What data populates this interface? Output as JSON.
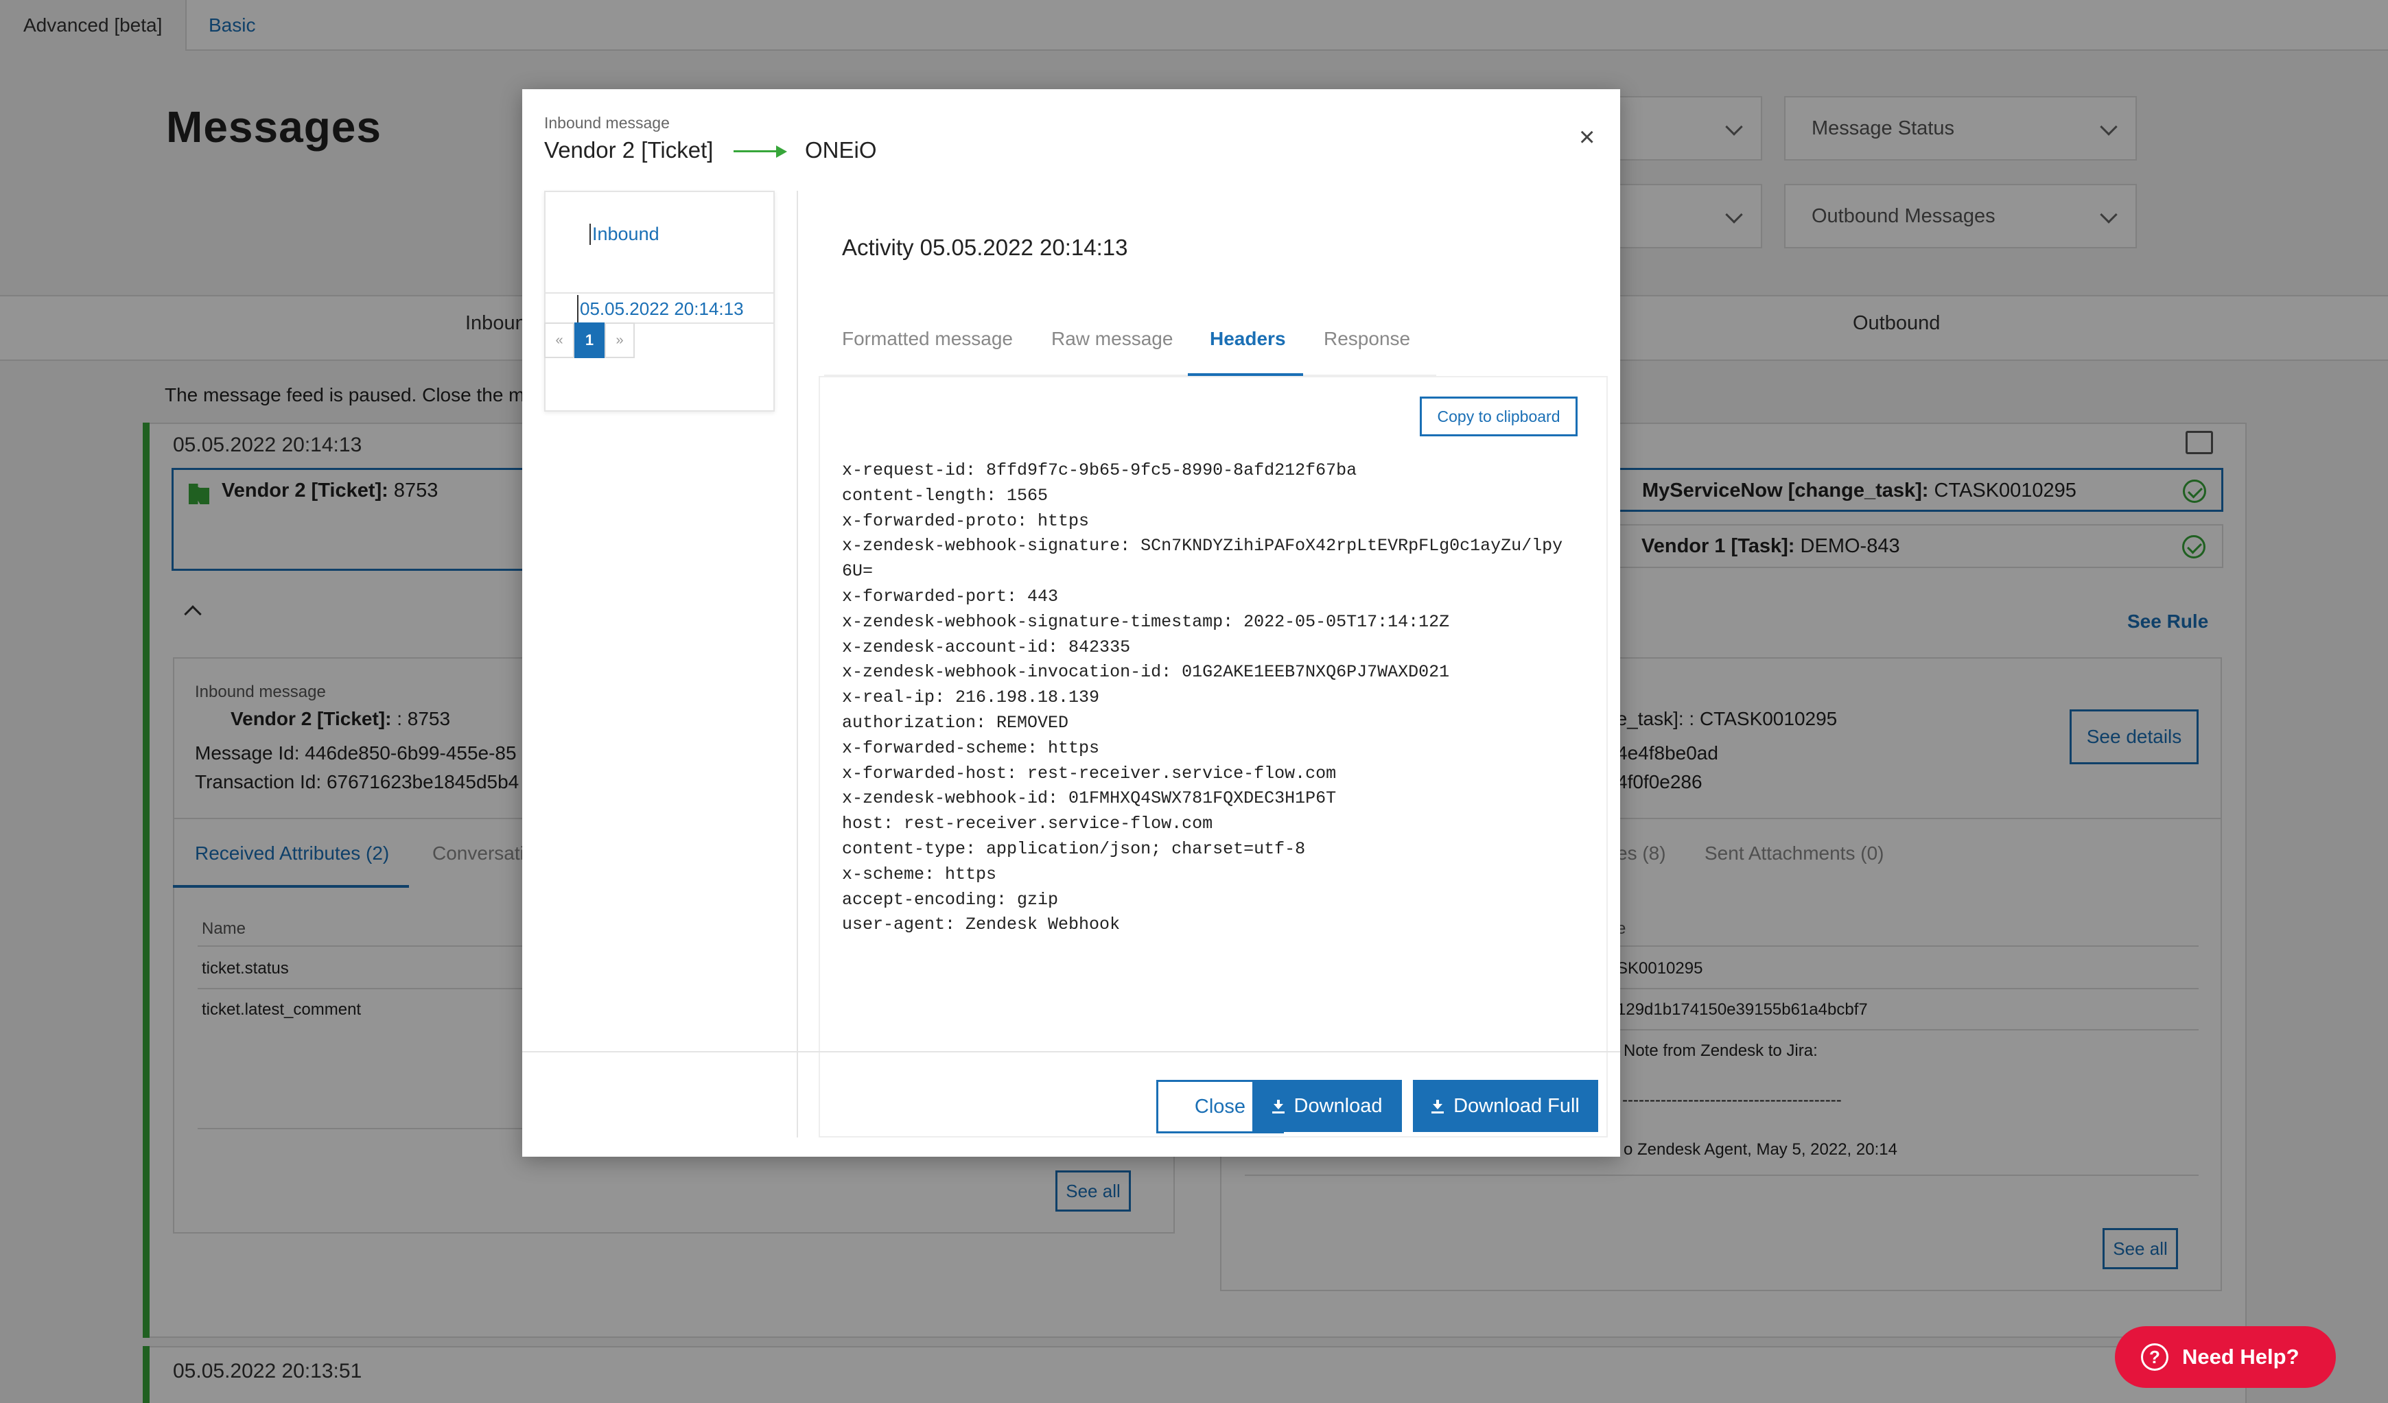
{
  "top_tabs": [
    "Advanced [beta]",
    "Basic"
  ],
  "page_title": "Messages",
  "filters": {
    "message_status": "Message Status",
    "outbound_messages": "Outbound Messages"
  },
  "subtabs": {
    "inbound": "Inbound",
    "outbound": "Outbound"
  },
  "feed_note": "The message feed is paused. Close the messages",
  "feed": [
    {
      "timestamp": "05.05.2022 20:14:13",
      "inbound_item": {
        "name": "Vendor 2 [Ticket]:",
        "id": "8753"
      },
      "outbound_items": [
        {
          "name": "MyServiceNow [change_task]:",
          "id": "CTASK0010295"
        },
        {
          "name": "Vendor 1 [Task]:",
          "id": "DEMO-843"
        }
      ],
      "see_rule": "See Rule",
      "inbound_detail": {
        "label": "Inbound message",
        "name": "Vendor 2 [Ticket]:",
        "id": ": 8753",
        "message_id": "Message Id: 446de850-6b99-455e-85",
        "transaction_id": "Transaction Id: 67671623be1845d5b4",
        "tabs": [
          "Received Attributes (2)",
          "Conversation"
        ],
        "col_name": "Name",
        "rows": [
          "ticket.status",
          "ticket.latest_comment"
        ],
        "see_all": "See all"
      },
      "outbound_detail": {
        "title": "ge_task]: : CTASK0010295",
        "line1": "4e4f8be0ad",
        "line2": "4f0f0e286",
        "see_details": "See details",
        "tabs": [
          "es (8)",
          "Sent Attachments (0)"
        ],
        "col_value": "e",
        "rows": [
          "SK0010295",
          "129d1b174150e39155b61a4bcbf7",
          "Note from Zendesk to Jira:",
          "----------------------------------------",
          "o Zendesk Agent, May 5, 2022, 20:14"
        ],
        "see_all": "See all"
      }
    },
    {
      "timestamp": "05.05.2022 20:13:51"
    }
  ],
  "modal": {
    "label": "Inbound message",
    "source": "Vendor 2 [Ticket]",
    "target": "ONEiO",
    "close_symbol": "×",
    "sidebar": {
      "title": "Inbound",
      "entry": "05.05.2022 20:14:13",
      "pager": {
        "prev": "«",
        "current": "1",
        "next": "»"
      }
    },
    "activity_title": "Activity 05.05.2022 20:14:13",
    "tabs": [
      "Formatted message",
      "Raw message",
      "Headers",
      "Response"
    ],
    "active_tab": "Headers",
    "copy_label": "Copy to clipboard",
    "headers": [
      "x-request-id: 8ffd9f7c-9b65-9fc5-8990-8afd212f67ba",
      "content-length: 1565",
      "x-forwarded-proto: https",
      "x-zendesk-webhook-signature: SCn7KNDYZihiPAFoX42rpLtEVRpFLg0c1ayZu/lpy",
      "6U=",
      "x-forwarded-port: 443",
      "x-zendesk-webhook-signature-timestamp: 2022-05-05T17:14:12Z",
      "x-zendesk-account-id: 842335",
      "x-zendesk-webhook-invocation-id: 01G2AKE1EEB7NXQ6PJ7WAXD021",
      "x-real-ip: 216.198.18.139",
      "authorization: REMOVED",
      "x-forwarded-scheme: https",
      "x-forwarded-host: rest-receiver.service-flow.com",
      "x-zendesk-webhook-id: 01FMHXQ4SWX781FQXDEC3H1P6T",
      "host: rest-receiver.service-flow.com",
      "content-type: application/json; charset=utf-8",
      "x-scheme: https",
      "accept-encoding: gzip",
      "user-agent: Zendesk Webhook"
    ],
    "buttons": {
      "close": "Close",
      "download": "Download",
      "download_full": "Download Full"
    }
  },
  "need_help": "Need Help?",
  "colors": {
    "accent": "#1a6fb5",
    "success": "#37a63a",
    "help": "#e5143c"
  }
}
